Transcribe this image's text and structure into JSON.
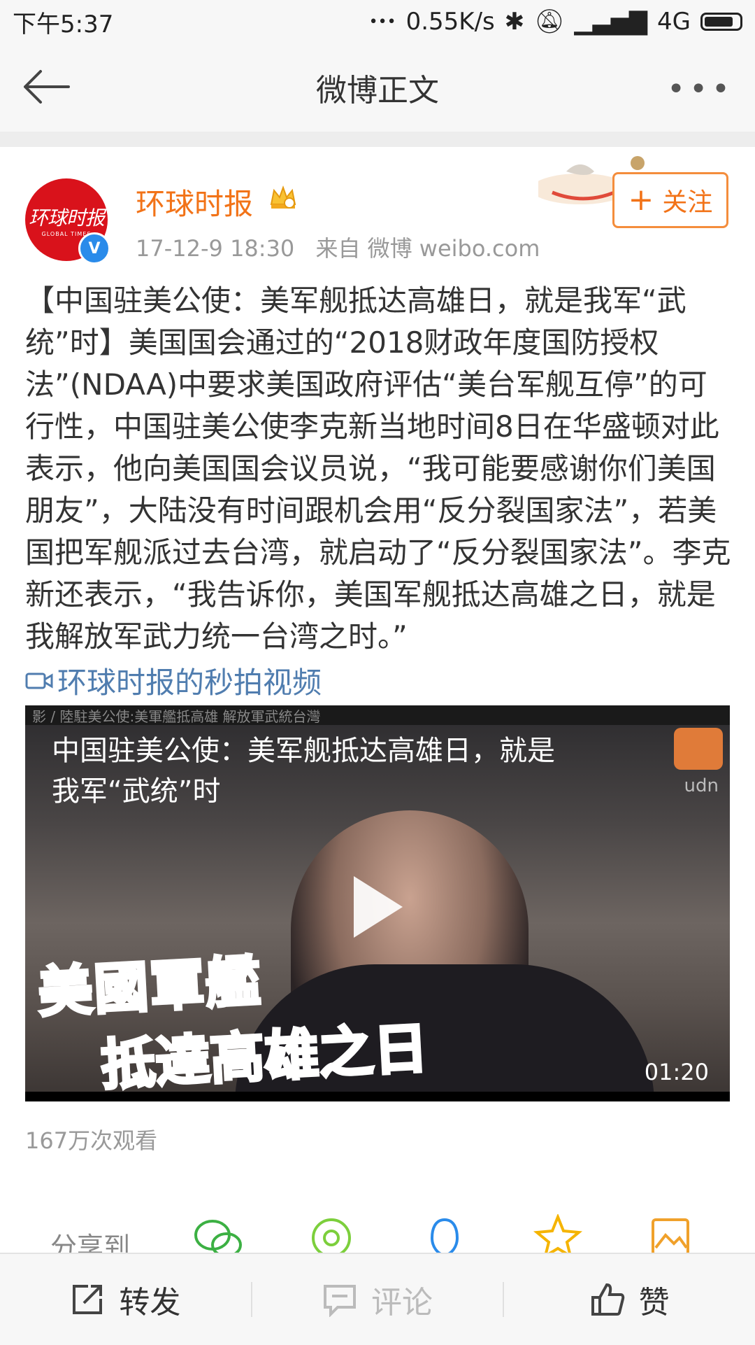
{
  "status_bar": {
    "time": "下午5:37",
    "dots": "•••",
    "speed": "0.55K/s",
    "network": "4G"
  },
  "nav": {
    "title": "微博正文",
    "more": "•••"
  },
  "post": {
    "author": "环球时报",
    "avatar_text": "环球时报",
    "avatar_subtext": "GLOBAL TIMES",
    "verified_mark": "V",
    "time": "17-12-9 18:30",
    "source": "来自 微博 weibo.com",
    "follow_label": "关注",
    "follow_plus": "+",
    "text": "【中国驻美公使：美军舰抵达高雄日，就是我军“武统”时】美国国会通过的“2018财政年度国防授权法”(NDAA)中要求美国政府评估“美台军舰互停”的可行性，中国驻美公使李克新当地时间8日在华盛顿对此表示，他向美国国会议员说，“我可能要感谢你们美国朋友”，大陆没有时间跟机会用“反分裂国家法”，若美国把军舰派过去台湾，就启动了“反分裂国家法”。李克新还表示，“我告诉你，美国军舰抵达高雄之日，就是我解放军武力统一台湾之时。”",
    "video_link": "环球时报的秒拍视频"
  },
  "video": {
    "strip_text": "影 / 陸駐美公使:美軍艦抵高雄 解放軍武統台灣",
    "title": "中国驻美公使：美军舰抵达高雄日，就是我军“武统”时",
    "caption_line1": "美國軍艦",
    "caption_line2_a": "抵達",
    "caption_line2_b": "高雄",
    "caption_line2_c": "之日",
    "duration": "01:20",
    "watermark": "udn",
    "views": "167万次观看"
  },
  "share": {
    "label": "分享到"
  },
  "toolbar": {
    "repost": "转发",
    "comment": "评论",
    "like": "赞"
  },
  "colors": {
    "accent": "#f27318",
    "link": "#507daf",
    "verified": "#2a8bea"
  }
}
